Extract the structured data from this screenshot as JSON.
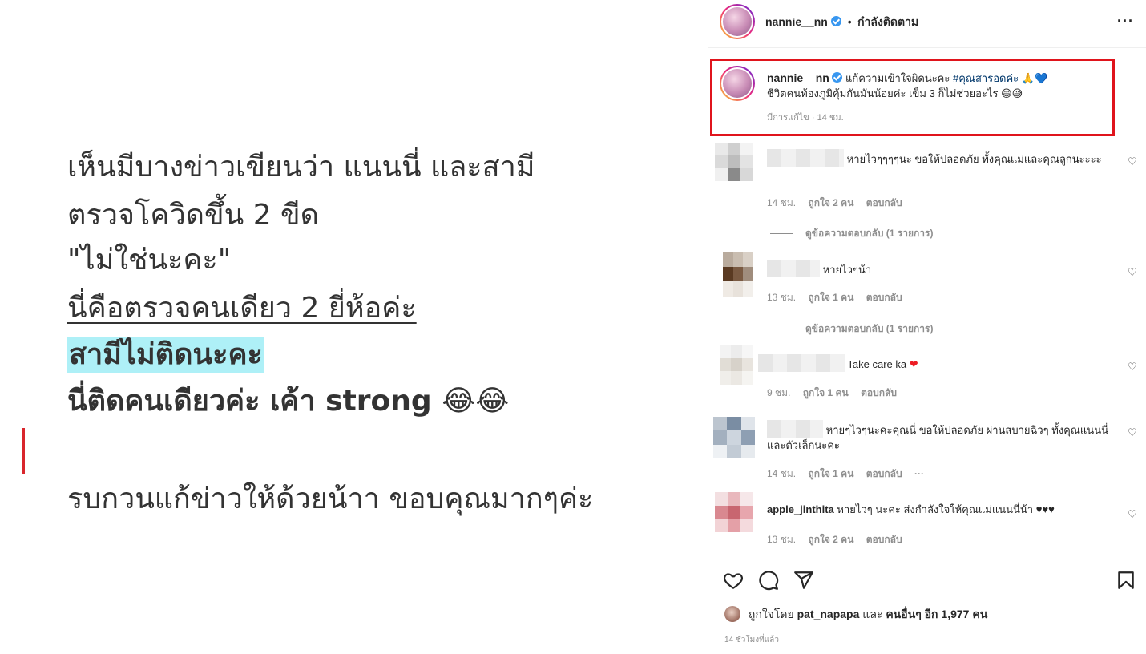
{
  "image": {
    "lines": [
      "เห็นมีบางข่าวเขียนว่า แนนนี่ และสามี",
      "ตรวจโควิดขึ้น 2 ขีด",
      "\"ไม่ใช่นะคะ\"",
      "นี่คือตรวจคนเดียว 2 ยี่ห้อค่ะ",
      "สามีไม่ติดนะคะ",
      "นี่ติดคนเดียวค่ะ เค้า strong 😂😂",
      "รบกวนแก้ข่าวให้ด้วยน้าา ขอบคุณมากๆค่ะ"
    ]
  },
  "header": {
    "username": "nannie__nn",
    "separator": "•",
    "following_label": "กำลังติดตาม",
    "more_label": "···"
  },
  "caption": {
    "username": "nannie__nn",
    "text_line1": "แก้ความเข้าใจผิดนะคะ",
    "hashtag": "#คุณสารอดค่ะ",
    "emoji1": "🙏💙",
    "text_line2": "ชีวิตคนท้องภูมิคุ้มกันมันน้อยค่ะ เข็ม 3 ก็ไม่ช่วยอะไร 😄😅",
    "edited_label": "มีการแก้ไข",
    "time": "14 ชม."
  },
  "comments": [
    {
      "username": "",
      "text": "หายไวๆๆๆๆนะ ขอให้ปลอดภัย ทั้งคุณแม่และคุณลูกนะะะะ",
      "time": "14 ชม.",
      "likes": "ถูกใจ 2 คน",
      "reply": "ตอบกลับ",
      "view_replies": "ดูข้อความตอบกลับ (1 รายการ)"
    },
    {
      "username": "",
      "text": "หายไวๆน้า",
      "time": "13 ชม.",
      "likes": "ถูกใจ 1 คน",
      "reply": "ตอบกลับ",
      "view_replies": "ดูข้อความตอบกลับ (1 รายการ)"
    },
    {
      "username": "",
      "text": "Take care ka",
      "emoji": "❤",
      "time": "9 ชม.",
      "likes": "ถูกใจ 1 คน",
      "reply": "ตอบกลับ"
    },
    {
      "username": "",
      "text": "หายๆไวๆนะคะคุณนี่ ขอให้ปลอดภัย ผ่านสบายฉิวๆ ทั้งคุณแนนนี่และตัวเล็กนะคะ",
      "time": "14 ชม.",
      "likes": "ถูกใจ 1 คน",
      "reply": "ตอบกลับ",
      "more": "···"
    },
    {
      "username": "apple_jinthita",
      "text": "หายไวๆ นะคะ ส่งกำลังใจให้คุณแม่แนนนี่น้า ♥♥♥",
      "time": "13 ชม.",
      "likes": "ถูกใจ 2 คน",
      "reply": "ตอบกลับ"
    }
  ],
  "footer": {
    "liked_by_prefix": "ถูกใจโดย",
    "liked_by_user": "pat_napapa",
    "and": "และ",
    "others": "คนอื่นๆ อีก 1,977 คน",
    "time_ago": "14 ชั่วโมงที่แล้ว"
  },
  "icons": [
    "heart-icon",
    "comment-icon",
    "share-icon",
    "bookmark-icon",
    "verified-icon",
    "more-icon"
  ],
  "colors": {
    "highlight": "#aef0f7",
    "frame": "#e0141c",
    "verified": "#3897f0",
    "hashtag": "#00376b"
  }
}
